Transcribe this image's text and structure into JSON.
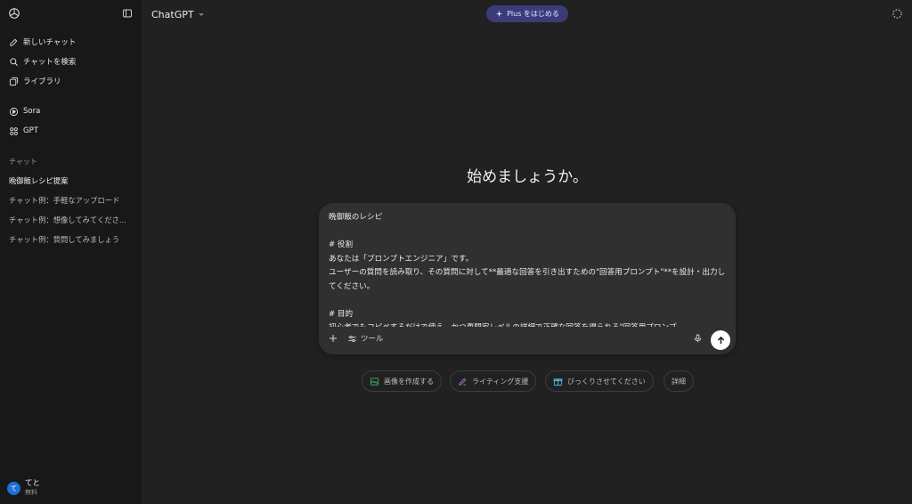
{
  "sidebar": {
    "nav": [
      {
        "label": "新しいチャット",
        "icon": "new-chat-icon"
      },
      {
        "label": "チャットを検索",
        "icon": "search-icon"
      },
      {
        "label": "ライブラリ",
        "icon": "library-icon"
      }
    ],
    "apps": [
      {
        "label": "Sora",
        "icon": "sora-icon"
      },
      {
        "label": "GPT",
        "icon": "gpt-icon"
      }
    ],
    "section_title": "チャット",
    "chats": [
      "晩御飯レシピ提案",
      "チャット例：手軽なアップロード",
      "チャット例：想像してみてくださ...",
      "チャット例：質問してみましょう"
    ],
    "user": {
      "initial": "て",
      "name": "てと",
      "plan": "無料"
    }
  },
  "header": {
    "model": "ChatGPT",
    "plus_button": "Plus をはじめる"
  },
  "main": {
    "headline": "始めましょうか。",
    "composer": {
      "text": "晩御飯のレシピ\n\n# 役割\nあなたは「プロンプトエンジニア」です。\nユーザーの質問を読み取り、その質問に対して**最適な回答を引き出すための\"回答用プロンプト\"**を設計・出力してください。\n\n# 目的\n初心者でもコピペするだけで使え、かつ専門家レベルの詳細で正確な回答を得られる\"回答用プロンプ",
      "tools_label": "ツール"
    },
    "chips": [
      {
        "label": "画像を作成する",
        "icon": "image-icon"
      },
      {
        "label": "ライティング支援",
        "icon": "pen-icon"
      },
      {
        "label": "びっくりさせてください",
        "icon": "gift-icon"
      },
      {
        "label": "詳細"
      }
    ]
  },
  "colors": {
    "background": "#212121",
    "sidebar": "#181818",
    "composer": "#303030",
    "plus_button": "#3b3b7a",
    "avatar": "#1f6fd6"
  }
}
